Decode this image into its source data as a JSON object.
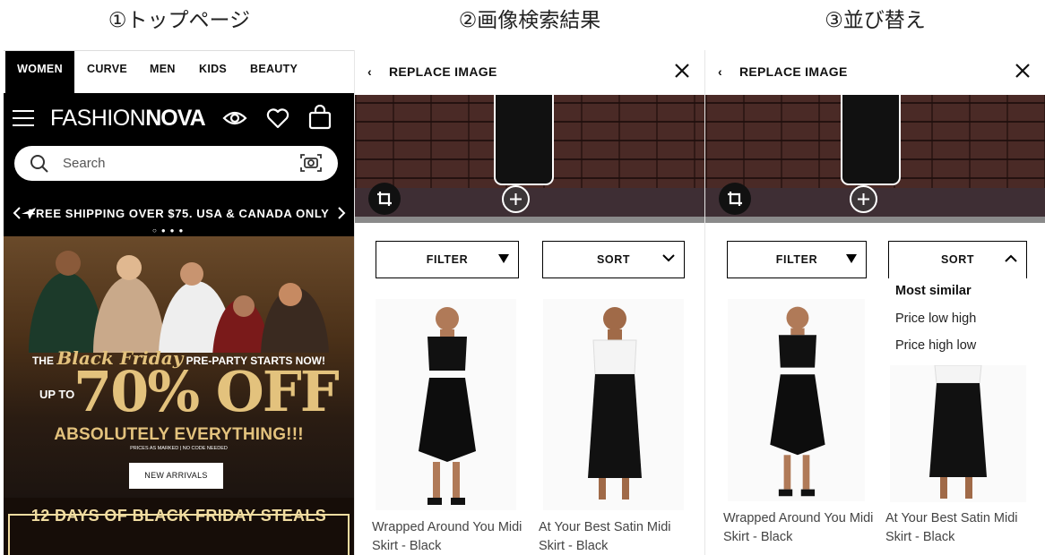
{
  "captions": [
    "①トップページ",
    "②画像検索結果",
    "③並び替え"
  ],
  "top_page": {
    "categories": [
      "WOMEN",
      "CURVE",
      "MEN",
      "KIDS",
      "BEAUTY"
    ],
    "brand_light": "FASHION",
    "brand_bold": "NOVA",
    "search_placeholder": "Search",
    "promo_text": "FREE SHIPPING OVER $75. USA & CANADA ONLY",
    "hero": {
      "line_the": "THE",
      "line_black_friday": "Black Friday",
      "line_preparty": "PRE-PARTY STARTS NOW!",
      "line_upto": "UP TO",
      "line_off": "70% OFF",
      "line_absolutely": "ABSOLUTELY EVERYTHING!!!",
      "line_prices": "PRICES AS MARKED | NO CODE NEEDED",
      "cta": "NEW ARRIVALS"
    },
    "banner2": "12 DAYS OF BLACK FRIDAY STEALS"
  },
  "search_results": {
    "back": "‹",
    "title": "REPLACE IMAGE",
    "filter_label": "FILTER",
    "sort_label": "SORT",
    "products": [
      {
        "name": "Wrapped Around You Midi Skirt - Black"
      },
      {
        "name": "At Your Best Satin Midi Skirt - Black"
      }
    ]
  },
  "sort_view": {
    "back": "‹",
    "title": "REPLACE IMAGE",
    "filter_label": "FILTER",
    "sort_label": "SORT",
    "sort_options": [
      "Most similar",
      "Price low high",
      "Price high low"
    ],
    "selected_option": "Most similar",
    "products": [
      {
        "name": "Wrapped Around You Midi Skirt - Black"
      },
      {
        "name": "At Your Best Satin Midi Skirt - Black"
      }
    ]
  },
  "colors": {
    "black": "#000000",
    "white": "#ffffff",
    "gold": "#e3c27d"
  }
}
